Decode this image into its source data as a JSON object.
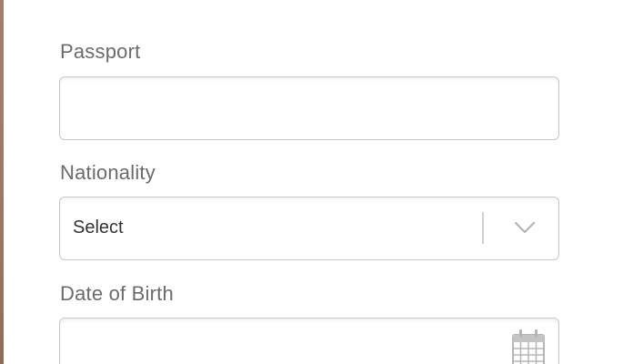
{
  "form": {
    "passport": {
      "label": "Passport",
      "value": "",
      "placeholder": ""
    },
    "nationality": {
      "label": "Nationality",
      "selected": "Select",
      "icon": "chevron-down-icon"
    },
    "date_of_birth": {
      "label": "Date of Birth",
      "value": "",
      "icon": "calendar-icon"
    }
  },
  "colors": {
    "label": "#6b6b6b",
    "border": "#c8c8c8",
    "icon": "#b5b5b5",
    "edge": "#a47e6c"
  }
}
